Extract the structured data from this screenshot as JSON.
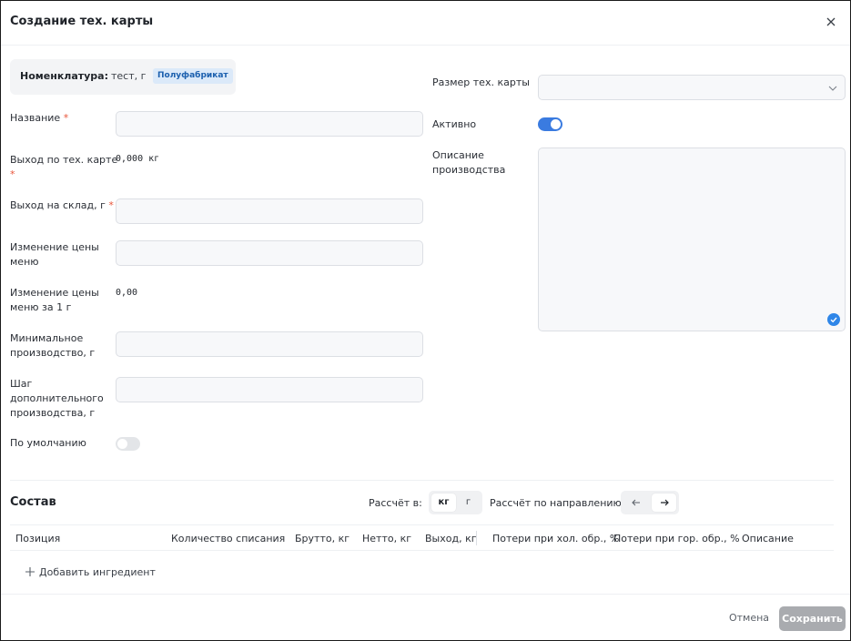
{
  "dialog": {
    "title": "Создание тех. карты"
  },
  "nomenclature": {
    "label": "Номенклатура:",
    "value": "тест, г",
    "badge": "Полуфабрикат"
  },
  "form_left": {
    "name": {
      "label": "Название",
      "required": "*",
      "value": ""
    },
    "yield_card": {
      "label": "Выход по тех. карте",
      "required": "*",
      "value": "0,000 кг"
    },
    "yield_storage": {
      "label": "Выход на склад, г",
      "required": "*",
      "value": ""
    },
    "menu_price_change": {
      "label_line1": "Изменение цены",
      "label_line2": "меню",
      "value": ""
    },
    "menu_price_change_per_g": {
      "label_line1": "Изменение цены",
      "label_line2": "меню за 1 г",
      "value": "0,00"
    },
    "min_production": {
      "label_line1": "Минимальное",
      "label_line2": "производство, г",
      "value": ""
    },
    "extra_step": {
      "label_line1": "Шаг",
      "label_line2": "дополнительного",
      "label_line3": "производства, г",
      "value": ""
    },
    "default": {
      "label": "По умолчанию",
      "on": false
    }
  },
  "form_right": {
    "card_size": {
      "label": "Размер тех. карты",
      "value": ""
    },
    "active": {
      "label": "Активно",
      "on": true
    },
    "description": {
      "label_line1": "Описание",
      "label_line2": "производства",
      "value": ""
    }
  },
  "composition": {
    "title": "Состав",
    "calc_in_label": "Рассчёт в:",
    "calc_in_options": [
      "кг",
      "г"
    ],
    "calc_in_selected": "кг",
    "calc_dir_label": "Рассчёт по направлению:",
    "calc_dir_selected": "forward",
    "columns": [
      "Позиция",
      "Количество списания",
      "Брутто, кг",
      "Нетто, кг",
      "Выход, кг",
      "Потери при хол. обр., %",
      "Потери при гор. обр., %",
      "Описание"
    ],
    "add_ingredient": "Добавить ингредиент"
  },
  "footer": {
    "cancel": "Отмена",
    "save": "Сохранить"
  },
  "colors": {
    "accent": "#3a7be0",
    "badge_bg": "#dbe9f9",
    "badge_text": "#1b5fae",
    "required": "#e8553a",
    "save_disabled": "#a9abaf"
  }
}
